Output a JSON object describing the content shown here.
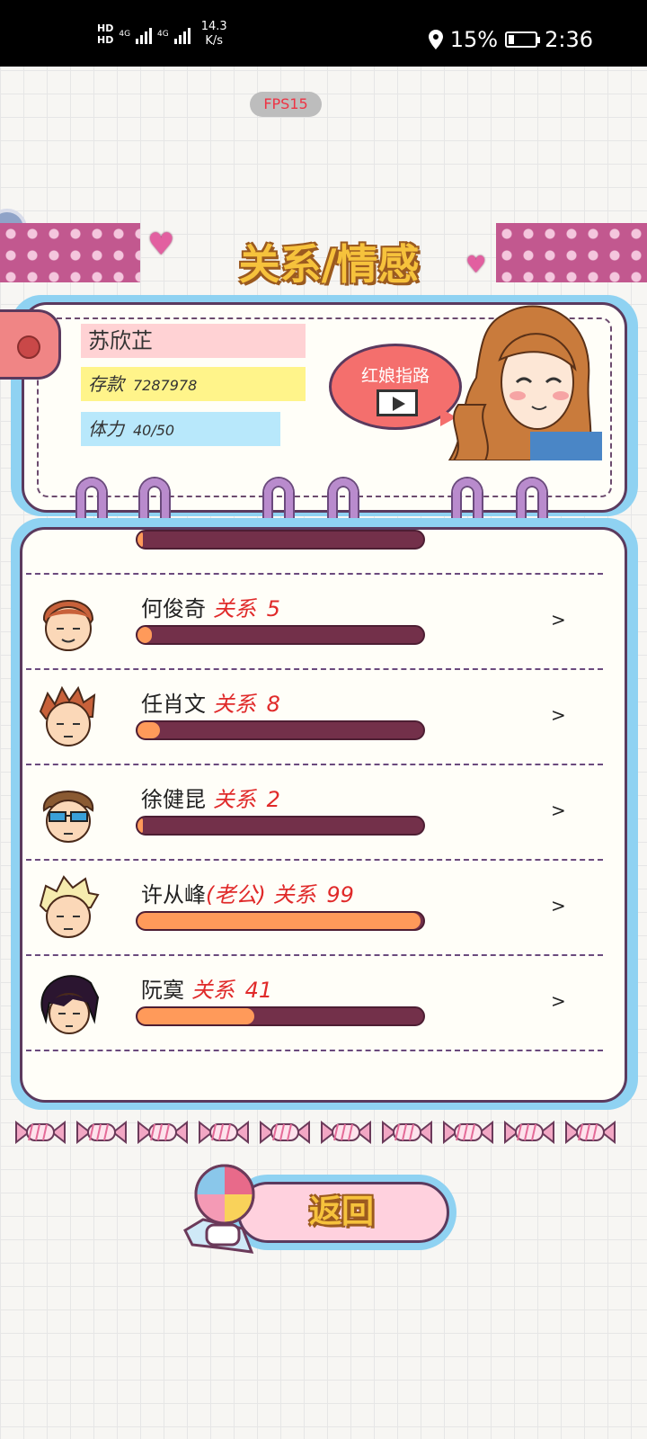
{
  "status_bar": {
    "hd1": "HD",
    "hd2": "HD",
    "net1": "4G",
    "net2": "4G",
    "speed_value": "14.3",
    "speed_unit": "K/s",
    "battery": "15%",
    "time": "2:36"
  },
  "fps": "FPS15",
  "title": "关系/情感",
  "profile": {
    "name": "苏欣芷",
    "money_label": "存款",
    "money_value": "7287978",
    "stamina_label": "体力",
    "stamina_value": "40/50"
  },
  "guide_button": {
    "label": "红娘指路",
    "icon": "video-play-icon"
  },
  "relationships": [
    {
      "name": "",
      "relation_label": "",
      "value": null,
      "fill": 0.02,
      "partial": true
    },
    {
      "name": "何俊奇",
      "relation_label": "关系",
      "value": "5",
      "fill": 0.05
    },
    {
      "name": "任肖文",
      "relation_label": "关系",
      "value": "8",
      "fill": 0.08
    },
    {
      "name": "徐健昆",
      "relation_label": "关系",
      "value": "2",
      "fill": 0.02
    },
    {
      "name": "许从峰",
      "tag": "(老公)",
      "relation_label": "关系",
      "value": "99",
      "fill": 0.99
    },
    {
      "name": "阮寞",
      "relation_label": "关系",
      "value": "41",
      "fill": 0.41
    }
  ],
  "chevron": ">",
  "return_button": {
    "label": "返回"
  },
  "colors": {
    "accent_title": "#f6c23c",
    "relation_text": "#e02a2a",
    "bar_empty": "#73304a",
    "bar_fill": "#ff9a5a",
    "frame_blue": "#8fd2f2"
  }
}
